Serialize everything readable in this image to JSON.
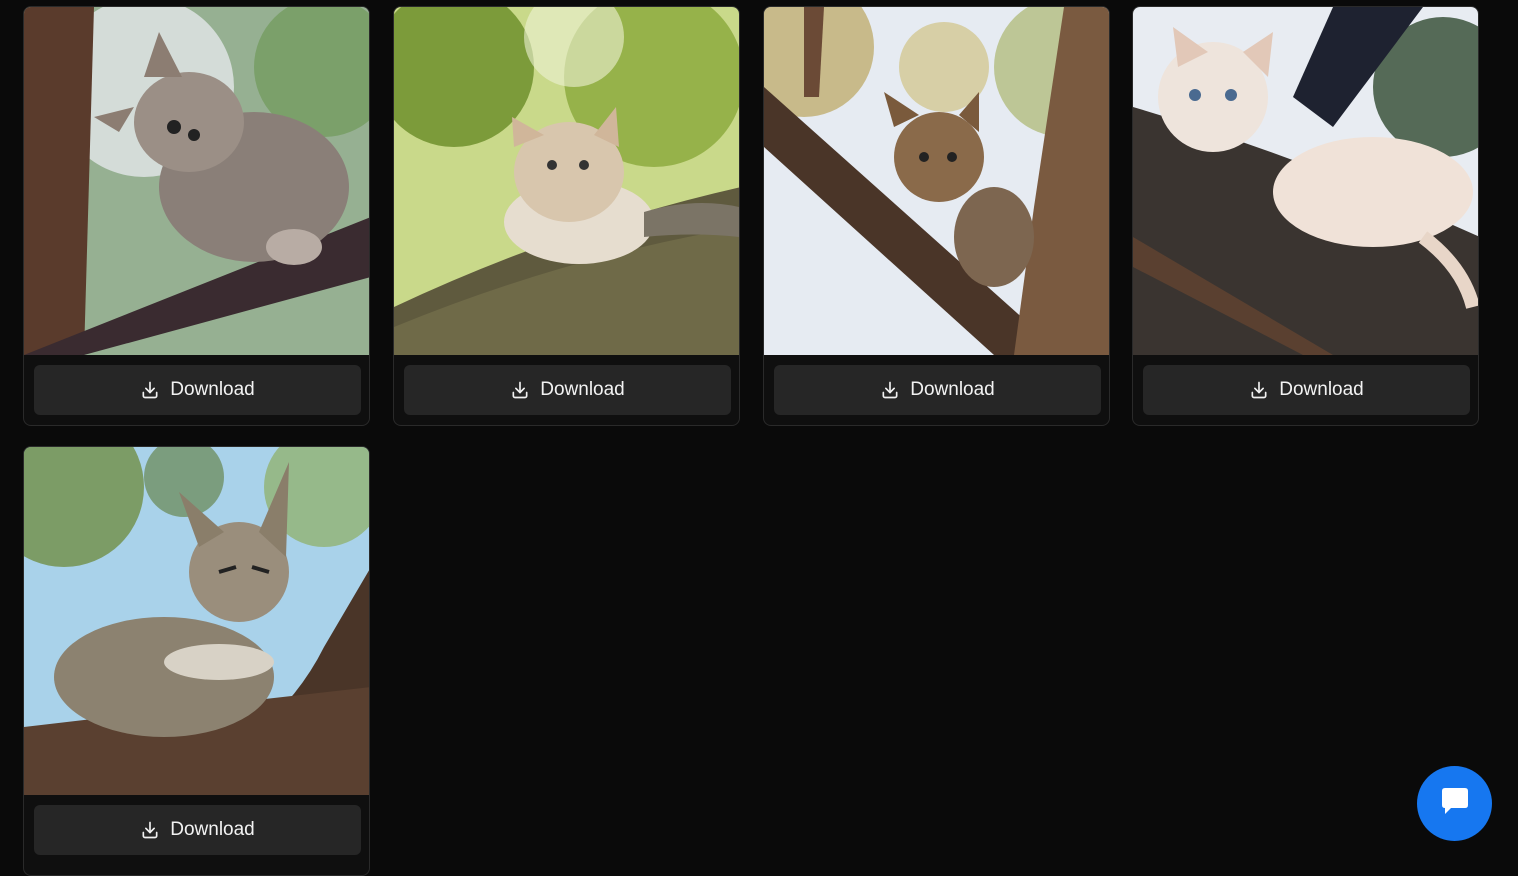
{
  "gallery": {
    "cards": [
      {
        "alt": "Kitten climbing a tree branch",
        "download_label": "Download"
      },
      {
        "alt": "Cat resting on a mossy branch",
        "download_label": "Download"
      },
      {
        "alt": "Tabby cat in a tree fork",
        "download_label": "Download"
      },
      {
        "alt": "White and orange cat lying on a branch",
        "download_label": "Download"
      },
      {
        "alt": "Tabby cat lounging on a tree trunk",
        "download_label": "Download"
      }
    ]
  },
  "icons": {
    "download": "download-icon",
    "chat": "chat-bubble-icon"
  },
  "colors": {
    "page_bg": "#0a0a0a",
    "card_border": "#2a2a2a",
    "button_bg": "#262626",
    "button_text": "#f2f2f2",
    "chat_accent": "#1677f0"
  }
}
